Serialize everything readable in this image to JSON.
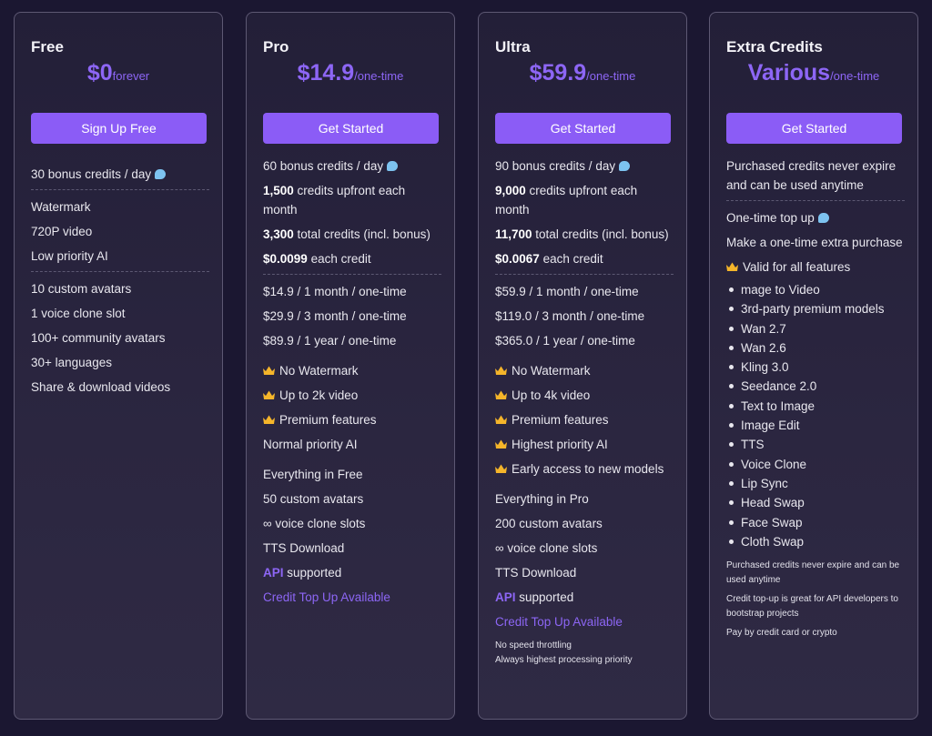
{
  "colors": {
    "accent": "#8b5cf6",
    "price": "#8d66f5",
    "bubble": "#7dc3f0",
    "crown": "#f5b52a"
  },
  "free": {
    "name": "Free",
    "price": "$0",
    "period": "forever",
    "cta": "Sign Up Free",
    "bonus": "30 bonus credits / day",
    "features_a": [
      "Watermark",
      "720P video",
      "Low priority AI"
    ],
    "features_b": [
      "10 custom avatars",
      "1 voice clone slot",
      "100+ community avatars",
      "30+ languages",
      "Share & download videos"
    ]
  },
  "pro": {
    "name": "Pro",
    "price": "$14.9",
    "period": "/one-time",
    "cta": "Get Started",
    "bonus": "60 bonus credits / day",
    "upfront_num": "1,500",
    "upfront_txt": " credits upfront each month",
    "total_num": "3,300",
    "total_txt": " total credits (incl. bonus)",
    "each_num": "$0.0099",
    "each_txt": " each credit",
    "options": [
      "$14.9 / 1 month / one-time",
      "$29.9 / 3 month / one-time",
      "$89.9 / 1 year / one-time"
    ],
    "crown_features": [
      "No Watermark",
      "Up to 2k video",
      "Premium features"
    ],
    "priority": "Normal priority AI",
    "extras": [
      "Everything in Free",
      "50 custom avatars",
      "∞ voice clone slots",
      "TTS Download"
    ],
    "api": "API",
    "api_txt": " supported",
    "topup": "Credit Top Up Available"
  },
  "ultra": {
    "name": "Ultra",
    "price": "$59.9",
    "period": "/one-time",
    "cta": "Get Started",
    "bonus": "90 bonus credits / day",
    "upfront_num": "9,000",
    "upfront_txt": " credits upfront each month",
    "total_num": "11,700",
    "total_txt": " total credits (incl. bonus)",
    "each_num": "$0.0067",
    "each_txt": " each credit",
    "options": [
      "$59.9 / 1 month / one-time",
      "$119.0 / 3 month / one-time",
      "$365.0 / 1 year / one-time"
    ],
    "crown_features": [
      "No Watermark",
      "Up to 4k video",
      "Premium features",
      "Highest priority AI",
      "Early access to new models"
    ],
    "extras": [
      "Everything in Pro",
      "200 custom avatars",
      "∞ voice clone slots",
      "TTS Download"
    ],
    "api": "API",
    "api_txt": " supported",
    "topup": "Credit Top Up Available",
    "notes": [
      "No speed throttling",
      "Always highest processing priority"
    ]
  },
  "extra": {
    "name": "Extra Credits",
    "price": "Various",
    "period": "/one-time",
    "cta": "Get Started",
    "intro": "Purchased credits never expire and can be used anytime",
    "topup": "One-time top up",
    "purchase": "Make a one-time extra purchase",
    "valid": "Valid for all features",
    "list": [
      "mage to Video",
      "3rd-party premium models",
      "Wan 2.7",
      "Wan 2.6",
      "Kling 3.0",
      "Seedance 2.0",
      "Text to Image",
      "Image Edit",
      "TTS",
      "Voice Clone",
      "Lip Sync",
      "Head Swap",
      "Face Swap",
      "Cloth Swap"
    ],
    "notes": [
      "Purchased credits never expire and can be used anytime",
      "Credit top-up is great for API developers to bootstrap projects",
      "Pay by credit card or crypto"
    ]
  }
}
